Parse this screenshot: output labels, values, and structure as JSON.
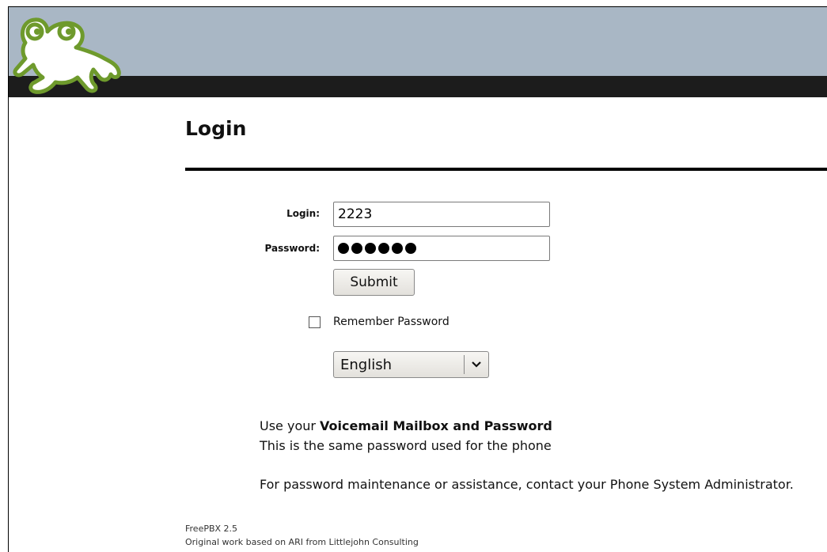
{
  "header": {
    "logo_icon": "frog-logo-icon",
    "colors": {
      "band": "#a9b7c5",
      "bar": "#1c1c1c",
      "logo_stroke": "#6e9a2c"
    }
  },
  "page": {
    "title": "Login"
  },
  "form": {
    "login_label": "Login:",
    "login_value": "2223",
    "password_label": "Password:",
    "password_mask_count": 6,
    "submit_label": "Submit",
    "remember_label": "Remember Password",
    "remember_checked": false,
    "language_selected": "English"
  },
  "info": {
    "line1_prefix": "Use your ",
    "line1_bold": "Voicemail Mailbox and Password",
    "line2": "This is the same password used for the phone",
    "line3": "For password maintenance or assistance, contact your Phone System Administrator."
  },
  "footer": {
    "version": "FreePBX 2.5",
    "credit": "Original work based on ARI from Littlejohn Consulting"
  }
}
